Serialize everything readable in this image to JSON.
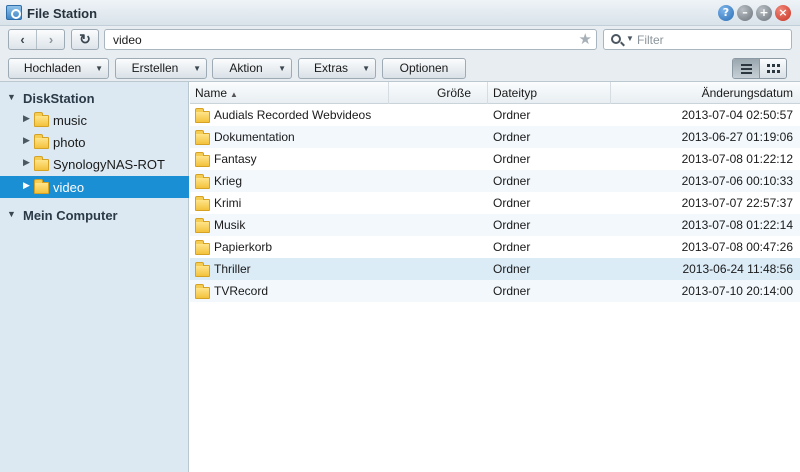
{
  "window": {
    "title": "File Station",
    "help": "?",
    "minimize": "–",
    "maximize": "+",
    "close": "×"
  },
  "nav": {
    "back": "‹",
    "forward": "›",
    "refresh": "↻",
    "path": "video",
    "star": "★",
    "filter_placeholder": "Filter"
  },
  "toolbar": {
    "upload": "Hochladen",
    "create": "Erstellen",
    "action": "Aktion",
    "extras": "Extras",
    "options": "Optionen",
    "active_view": "list"
  },
  "sidebar": {
    "root1": "DiskStation",
    "items": [
      {
        "label": "music"
      },
      {
        "label": "photo"
      },
      {
        "label": "SynologyNAS-ROT"
      },
      {
        "label": "video",
        "selected": true
      }
    ],
    "root2": "Mein Computer"
  },
  "columns": {
    "name": "Name",
    "size": "Größe",
    "type": "Dateityp",
    "modified": "Änderungsdatum"
  },
  "files": [
    {
      "name": "Audials Recorded Webvideos",
      "type": "Ordner",
      "modified": "2013-07-04 02:50:57"
    },
    {
      "name": "Dokumentation",
      "type": "Ordner",
      "modified": "2013-06-27 01:19:06"
    },
    {
      "name": "Fantasy",
      "type": "Ordner",
      "modified": "2013-07-08 01:22:12"
    },
    {
      "name": "Krieg",
      "type": "Ordner",
      "modified": "2013-07-06 00:10:33"
    },
    {
      "name": "Krimi",
      "type": "Ordner",
      "modified": "2013-07-07 22:57:37"
    },
    {
      "name": "Musik",
      "type": "Ordner",
      "modified": "2013-07-08 01:22:14"
    },
    {
      "name": "Papierkorb",
      "type": "Ordner",
      "modified": "2013-07-08 00:47:26"
    },
    {
      "name": "Thriller",
      "type": "Ordner",
      "modified": "2013-06-24 11:48:56"
    },
    {
      "name": "TVRecord",
      "type": "Ordner",
      "modified": "2013-07-10 20:14:00"
    }
  ],
  "colors": {
    "selection": "#1b8fd3",
    "sidebar_bg": "#dce9f2",
    "folder": "#f3c23c"
  }
}
